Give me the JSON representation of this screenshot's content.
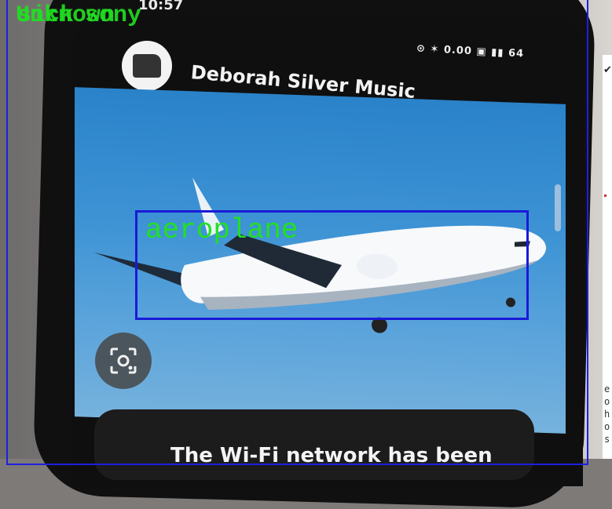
{
  "scene": {
    "status_time": "10:57",
    "status_icons": "⊙ ✶ 0.00 ▣ ▮▮ 64",
    "channel_name": "Deborah Silver Music",
    "toast_text": "The Wi-Fi network has been",
    "side_text_lines": [
      "e",
      "o",
      "h",
      "o",
      "s"
    ],
    "monitor_tick": "✔"
  },
  "detections": {
    "frame_labels": [
      "Unknown",
      "sick",
      "sony"
    ],
    "box_label": "aeroplane"
  },
  "colors": {
    "box": "#1a1ad8",
    "label": "#22e022",
    "sky": "#3d93d4"
  }
}
